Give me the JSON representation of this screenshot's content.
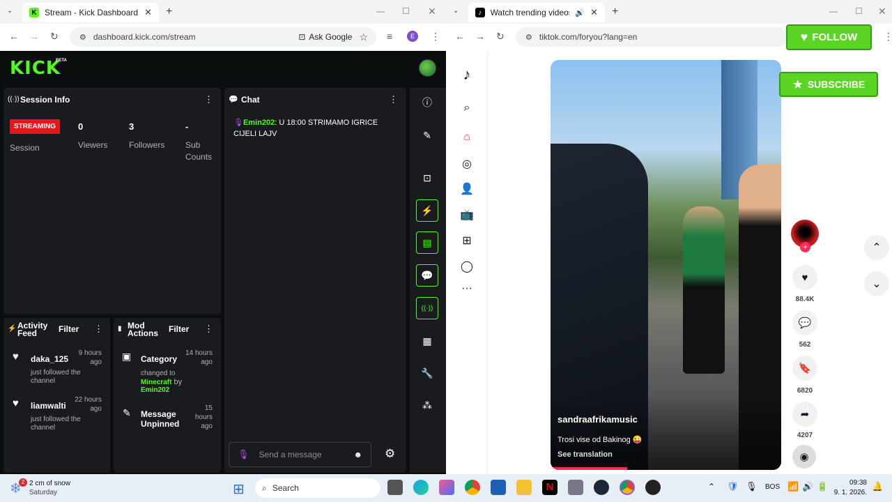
{
  "left_browser": {
    "tab_title": "Stream - Kick Dashboard",
    "url": "dashboard.kick.com/stream",
    "ask_google": "Ask Google",
    "profile_initial": "E"
  },
  "right_browser": {
    "tab_title": "Watch trending videos for y",
    "url": "tiktok.com/foryou?lang=en"
  },
  "kick": {
    "logo": "KICK",
    "beta": "BETA",
    "session": {
      "title": "Session Info",
      "status": "STREAMING",
      "session_label": "Session",
      "viewers_value": "0",
      "viewers_label": "Viewers",
      "followers_value": "3",
      "followers_label": "Followers",
      "subs_value": "-",
      "subs_label_1": "Sub",
      "subs_label_2": "Counts"
    },
    "chat": {
      "title": "Chat",
      "user": "Emin202",
      "message_1": ": U 18:00 STRIMAMO IGRICE",
      "message_2": "CIJELI LAJV",
      "placeholder": "Send a message"
    },
    "activity": {
      "title_1": "Activity",
      "title_2": "Feed",
      "filter": "Filter",
      "items": [
        {
          "user": "daka_125",
          "time_1": "9 hours",
          "time_2": "ago",
          "desc_1": "just followed the",
          "desc_2": "channel"
        },
        {
          "user": "liamwalti",
          "time_1": "22 hours",
          "time_2": "ago",
          "desc_1": "just followed the",
          "desc_2": "channel"
        }
      ]
    },
    "mod": {
      "title_1": "Mod",
      "title_2": "Actions",
      "filter": "Filter",
      "item1": {
        "title": "Category",
        "time_1": "14 hours",
        "time_2": "ago",
        "line_1": "changed to",
        "game": "Minecraft",
        "by": " by",
        "user": "Emin202"
      },
      "item2": {
        "title_1": "Message",
        "title_2": "Unpinned",
        "time_1": "15",
        "time_2": "hours",
        "time_3": "ago"
      }
    }
  },
  "tiktok": {
    "follow": "FOLLOW",
    "subscribe": "SUBSCRIBE",
    "username": "sandraafrikamusic",
    "caption": "Trosi vise od Bakinog 😜",
    "see_translation": "See translation",
    "likes": "88.4K",
    "comments": "562",
    "saves": "6820",
    "shares": "4207"
  },
  "taskbar": {
    "weather_1": "2 cm of snow",
    "weather_2": "Saturday",
    "weather_badge": "2",
    "search": "Search",
    "lang": "BOS",
    "time": "09:38",
    "date": "9. 1. 2026."
  },
  "colors": {
    "kick_green": "#53fc18",
    "tiktok_red": "#fe2c55",
    "streaming_red": "#e4171b"
  }
}
